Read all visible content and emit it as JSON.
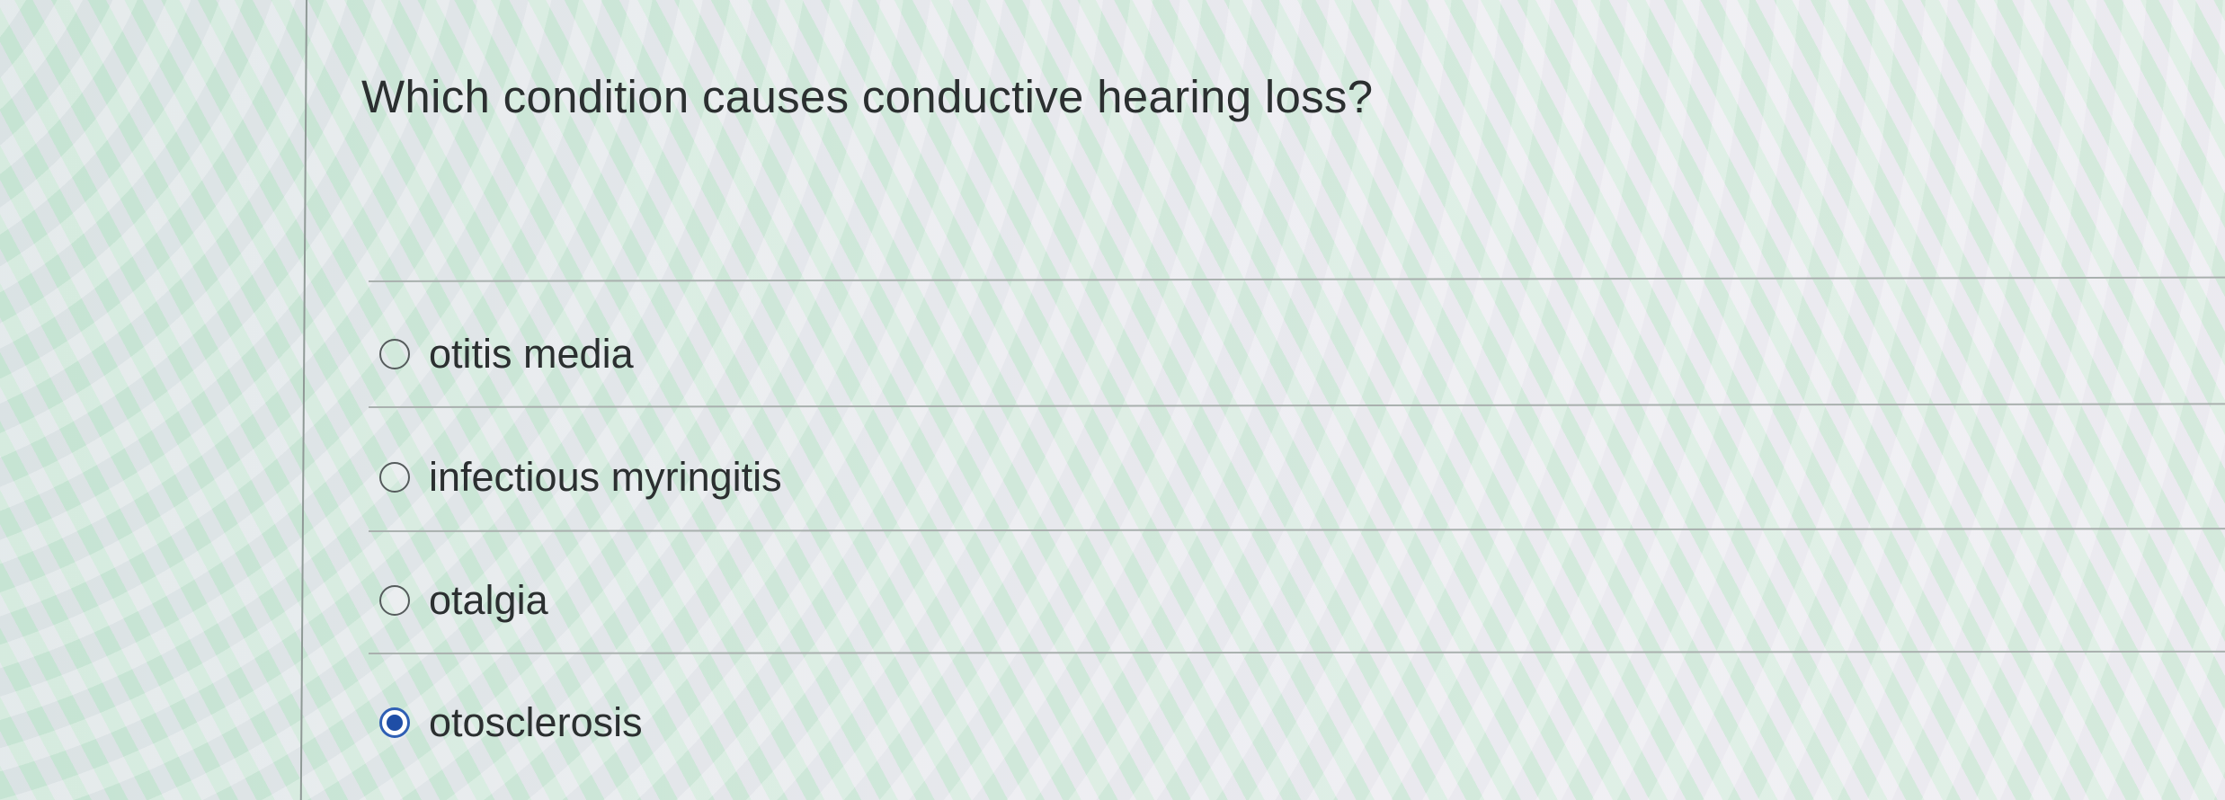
{
  "question": {
    "text": "Which condition causes conductive hearing loss?"
  },
  "options": [
    {
      "label": "otitis media",
      "selected": false
    },
    {
      "label": "infectious myringitis",
      "selected": false
    },
    {
      "label": "otalgia",
      "selected": false
    },
    {
      "label": "otosclerosis",
      "selected": true
    }
  ],
  "colors": {
    "selected_radio": "#1f4ea6",
    "text": "#2b2f30",
    "divider": "#a9b0ae"
  }
}
